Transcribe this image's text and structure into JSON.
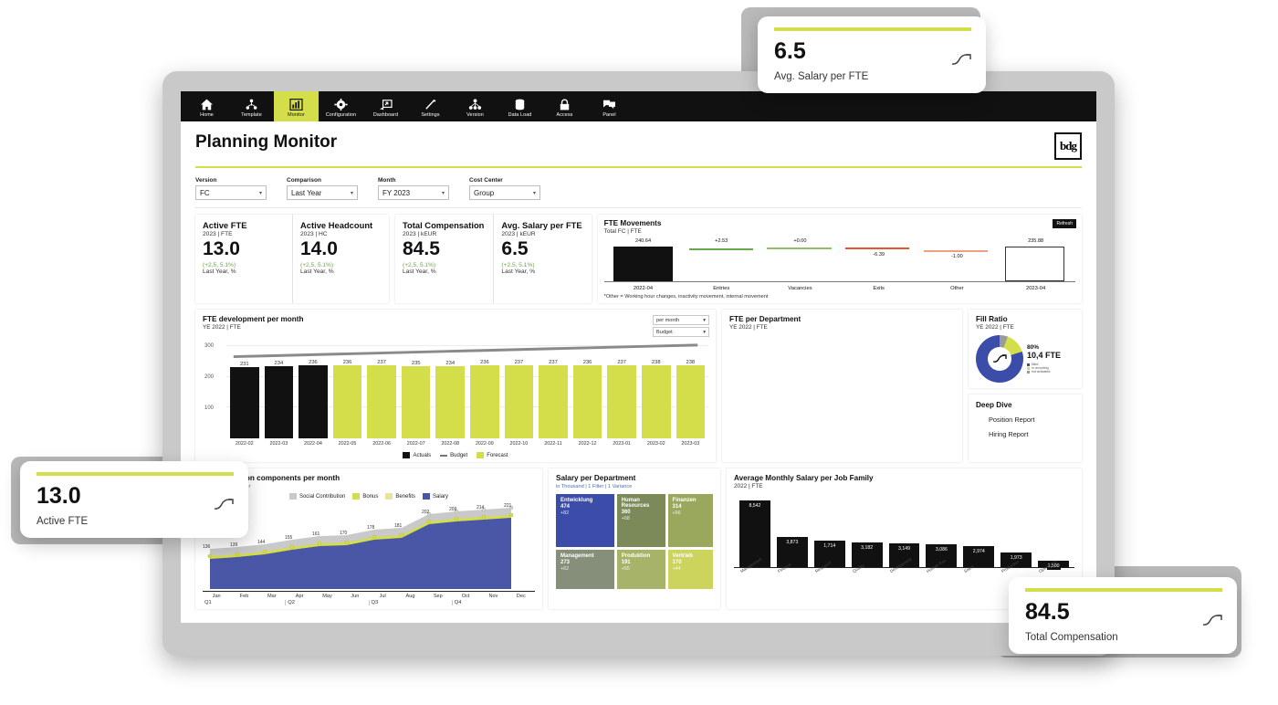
{
  "nav": {
    "items": [
      {
        "label": "Home",
        "icon": "home-icon",
        "active": false
      },
      {
        "label": "Template",
        "icon": "template-icon",
        "active": false
      },
      {
        "label": "Monitor",
        "icon": "chart-bar-icon",
        "active": true
      },
      {
        "label": "Configuration",
        "icon": "gear-icon",
        "active": false
      },
      {
        "label": "Dashboard",
        "icon": "dashboard-icon",
        "active": false
      },
      {
        "label": "Settings",
        "icon": "wrench-icon",
        "active": false
      },
      {
        "label": "Version",
        "icon": "version-tree-icon",
        "active": false
      },
      {
        "label": "Data Load",
        "icon": "database-icon",
        "active": false
      },
      {
        "label": "Access",
        "icon": "lock-icon",
        "active": false
      },
      {
        "label": "Panel",
        "icon": "chat-panel-icon",
        "active": false
      }
    ]
  },
  "header": {
    "title": "Planning Monitor",
    "logo": "bdg"
  },
  "filters": [
    {
      "label": "Version",
      "value": "FC"
    },
    {
      "label": "Comparison",
      "value": "Last Year"
    },
    {
      "label": "Month",
      "value": "FY 2023"
    },
    {
      "label": "Cost Center",
      "value": "Group"
    }
  ],
  "kpis": [
    {
      "name": "Active FTE",
      "meta": "2023 | FTE",
      "value": "13.0",
      "delta": "(+2,5, 5.1%)",
      "delta_label": "Last Year, %"
    },
    {
      "name": "Active Headcount",
      "meta": "2023 | HC",
      "value": "14.0",
      "delta": "(+2,5, 5.1%)",
      "delta_label": "Last Year, %"
    },
    {
      "name": "Total Compensation",
      "meta": "2023 | kEUR",
      "value": "84.5",
      "delta": "(+2,5, 5.1%)",
      "delta_label": "Last Year, %"
    },
    {
      "name": "Avg. Salary per FTE",
      "meta": "2023 | kEUR",
      "value": "6.5",
      "delta": "(+2,5, 5.1%)",
      "delta_label": "Last Year, %"
    }
  ],
  "waterfall": {
    "title": "FTE Movements",
    "subtitle": "Total FC | FTE",
    "refresh_label": "Refresh",
    "note": "*Other = Working hour changes, inactivity movement, internal movement",
    "chart_data": {
      "type": "bar",
      "categories": [
        "2022-04",
        "Entries",
        "Vacancies",
        "Exits",
        "Other",
        "2023-04"
      ],
      "values": [
        "240.64",
        "+2.53",
        "+0.00",
        "-6.39",
        "-1.00",
        "235.88"
      ],
      "title": "FTE Movements"
    }
  },
  "fte_development": {
    "title": "FTE development per month",
    "subtitle": "YE 2022 | FTE",
    "select_granularity": "per month",
    "select_measure": "Budget",
    "legend": [
      {
        "label": "Actuals",
        "color": "#111111",
        "type": "bar"
      },
      {
        "label": "Budget",
        "color": "#777777",
        "type": "line"
      },
      {
        "label": "Forecast",
        "color": "#d4dd4a",
        "type": "bar"
      }
    ],
    "chart_data": {
      "type": "bar",
      "title": "FTE development per month",
      "ylabel": "FTE",
      "ylim": [
        0,
        320
      ],
      "yticks": [
        100,
        200,
        300
      ],
      "categories": [
        "2022-02",
        "2022-03",
        "2022-04",
        "2022-05",
        "2022-06",
        "2022-07",
        "2022-08",
        "2022-09",
        "2022-10",
        "2022-11",
        "2022-12",
        "2023-01",
        "2023-02",
        "2023-03"
      ],
      "series": [
        {
          "name": "Actuals",
          "values": [
            231,
            234,
            236,
            null,
            null,
            null,
            null,
            null,
            null,
            null,
            null,
            null,
            null,
            null
          ]
        },
        {
          "name": "Forecast",
          "values": [
            null,
            null,
            null,
            236,
            237,
            235,
            234,
            236,
            237,
            237,
            236,
            237,
            238,
            238
          ]
        },
        {
          "name": "Budget",
          "values": [
            285,
            287,
            289,
            291,
            293,
            295,
            297,
            299,
            301,
            303,
            305,
            307,
            309,
            311
          ]
        }
      ]
    }
  },
  "fte_per_department": {
    "title": "FTE per Department",
    "subtitle": "YE 2022 | FTE"
  },
  "fill_ratio": {
    "title": "Fill Ratio",
    "subtitle": "YE 2022 | FTE",
    "percent": "80%",
    "fte": "10,4 FTE",
    "legend": [
      {
        "label": "filled",
        "color": "#3b4da8"
      },
      {
        "label": "in recruiting",
        "color": "#d4dd4a"
      },
      {
        "label": "not activated",
        "color": "#9a9a9a"
      }
    ],
    "chart_data": {
      "type": "pie",
      "title": "Fill Ratio",
      "categories": [
        "filled",
        "in recruiting",
        "not activated"
      ],
      "values": [
        80,
        14,
        6
      ]
    }
  },
  "deep_dive": {
    "title": "Deep Dive",
    "links": [
      "Position Report",
      "Hiring Report"
    ]
  },
  "comp_components": {
    "title": "Compensation components per month",
    "sub_links": "in Thousand | 1 Filter",
    "legend": [
      {
        "label": "Social Contribution",
        "color": "#c9c9c9"
      },
      {
        "label": "Bonus",
        "color": "#d4dd4a"
      },
      {
        "label": "Benefits",
        "color": "#e8e3a0"
      },
      {
        "label": "Salary",
        "color": "#4a56a6"
      }
    ],
    "quarters": [
      "Q1",
      "Q2",
      "Q3",
      "Q4"
    ],
    "chart_data": {
      "type": "area",
      "title": "Compensation components per month",
      "categories": [
        "Jan",
        "Feb",
        "Mar",
        "Apr",
        "May",
        "Jun",
        "Jul",
        "Aug",
        "Sep",
        "Oct",
        "Nov",
        "Dec"
      ],
      "series": [
        {
          "name": "Salary",
          "values": [
            136,
            139,
            144,
            155,
            161,
            170,
            178,
            181,
            202,
            209,
            214,
            221
          ]
        },
        {
          "name": "Social Contribution",
          "values": [
            25,
            26,
            26,
            27,
            28,
            28,
            31,
            32,
            51,
            33,
            54,
            55
          ]
        }
      ]
    }
  },
  "salary_per_department": {
    "title": "Salary per Department",
    "sub_links": "in Thousand | 1 Filter | 1 Variance",
    "chart_data": {
      "type": "treemap",
      "title": "Salary per Department",
      "tiles": [
        {
          "name": "Entwicklung",
          "value": "474",
          "delta": "+82",
          "color": "#3b4da8"
        },
        {
          "name": "Human Resources",
          "value": "360",
          "delta": "+68",
          "color": "#7c8a5a"
        },
        {
          "name": "Finanzen",
          "value": "314",
          "delta": "+56",
          "color": "#9aa85e"
        },
        {
          "name": "Management",
          "value": "273",
          "delta": "+62",
          "color": "#868f7a"
        },
        {
          "name": "Produktion",
          "value": "191",
          "delta": "+55",
          "color": "#a8b36a"
        },
        {
          "name": "Vertrieb",
          "value": "170",
          "delta": "+44",
          "color": "#cdd45e"
        }
      ]
    }
  },
  "job_family": {
    "title": "Average Monthly Salary per Job Family",
    "subtitle": "2022 | FTE",
    "chart_data": {
      "type": "bar",
      "title": "Average Monthly Salary per Job Family",
      "categories": [
        "Management",
        "Finance",
        "Research",
        "Quality",
        "Development",
        "Human Res.",
        "Sales",
        "Production",
        "Operations"
      ],
      "values": [
        8542,
        3873,
        1714,
        3182,
        3149,
        3086,
        2974,
        1973,
        1500
      ],
      "labels": [
        "8,542",
        "3,873",
        "1,714",
        "3,182",
        "3,149",
        "3,086",
        "2,974",
        "1,973",
        "1,500"
      ]
    }
  },
  "float_cards": [
    {
      "value": "6.5",
      "label": "Avg. Salary per FTE"
    },
    {
      "value": "13.0",
      "label": "Active FTE"
    },
    {
      "value": "84.5",
      "label": "Total Compensation"
    }
  ]
}
